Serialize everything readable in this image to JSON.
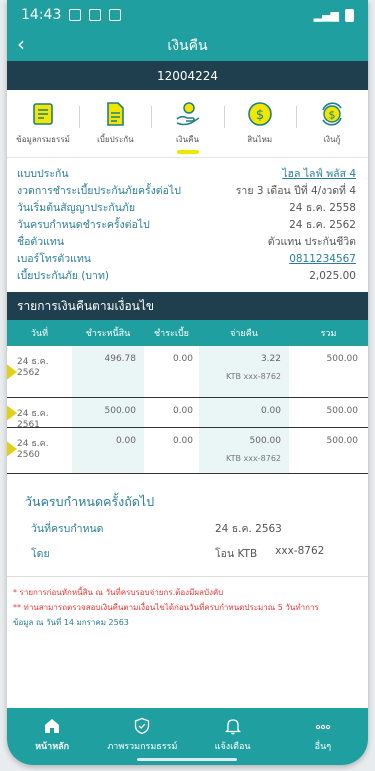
{
  "status_bar": {
    "time": "14:43"
  },
  "header": {
    "title": "เงินคืน",
    "policy_number": "12004224"
  },
  "tabs": [
    {
      "label": "ข้อมูลกรมธรรม์",
      "icon": "document-icon"
    },
    {
      "label": "เบี้ยประกัน",
      "icon": "premium-icon"
    },
    {
      "label": "เงินคืน",
      "icon": "refund-icon",
      "active": true
    },
    {
      "label": "สินไหม",
      "icon": "claim-dollar-icon"
    },
    {
      "label": "เงินกู้",
      "icon": "loan-dollar-icon"
    }
  ],
  "details": [
    {
      "label": "แบบประกัน",
      "value": "ไฮล ไลฟ์ พลัส 4",
      "link": true
    },
    {
      "label": "งวดการชำระเบี้ยประกันภัยครั้งต่อไป",
      "value": "ราย 3 เดือน ปีที่ 4/งวดที่ 4",
      "link": false
    },
    {
      "label": "วันเริ่มต้นสัญญาประกันภัย",
      "value": "24 ธ.ค. 2558",
      "link": false
    },
    {
      "label": "วันครบกำหนดชำระครั้งต่อไป",
      "value": "24 ธ.ค. 2562",
      "link": false
    },
    {
      "label": "ชื่อตัวแทน",
      "value": "ตัวแทน ประกันชีวิต",
      "link": false
    },
    {
      "label": "เบอร์โทรตัวแทน",
      "value": "0811234567",
      "link": true
    },
    {
      "label": "เบี้ยประกันภัย (บาท)",
      "value": "2,025.00",
      "link": false
    }
  ],
  "refund_section": {
    "title": "รายการเงินคืนตามเงื่อนไข",
    "columns": [
      "วันที่",
      "ชำระหนี้สิน",
      "ชำระเบี้ย",
      "จ่ายคืน",
      "รวม"
    ],
    "rows": [
      {
        "date": "24 ธ.ค. 2562",
        "debt": "496.78",
        "premium": "0.00",
        "paid": "3.22",
        "total": "500.00",
        "bank": "KTB xxx-8762"
      },
      {
        "date": "24 ธ.ค. 2561",
        "debt": "500.00",
        "premium": "0.00",
        "paid": "0.00",
        "total": "500.00",
        "bank": ""
      },
      {
        "date": "24 ธ.ค. 2560",
        "debt": "0.00",
        "premium": "0.00",
        "paid": "500.00",
        "total": "500.00",
        "bank": "KTB xxx-8762"
      }
    ]
  },
  "next_due": {
    "title": "วันครบกำหนดครั้งถัดไป",
    "due_label": "วันที่ครบกำหนด",
    "due_value": "24 ธ.ค. 2563",
    "by_label": "โดย",
    "by_method": "โอน KTB",
    "by_account": "xxx-8762"
  },
  "notes": {
    "note1": "* รายการก่อนหักหนี้สิน ณ วันที่ครบรอบจ่ายกร.ต้องมีผลบังคับ",
    "note2": "** ท่านสามารถตรวจสอบเงินคืนตามเงื่อนไขได้ก่อนวันที่ครบกำหนดประมาณ 5 วันทำการ",
    "note3": "ข้อมูล ณ วันที่ 14 มกราคม 2563"
  },
  "bottom_nav": [
    {
      "label": "หน้าหลัก",
      "icon": "home-icon",
      "active": true
    },
    {
      "label": "ภาพรวมกรมธรรม์",
      "icon": "shield-check-icon"
    },
    {
      "label": "แจ้งเตือน",
      "icon": "bell-icon"
    },
    {
      "label": "อื่นๆ",
      "icon": "more-icon"
    }
  ],
  "colors": {
    "primary": "#1f9fa0",
    "dark": "#203f4e",
    "accent": "#f1e600",
    "link": "#2a7f96",
    "warning": "#e53935"
  }
}
